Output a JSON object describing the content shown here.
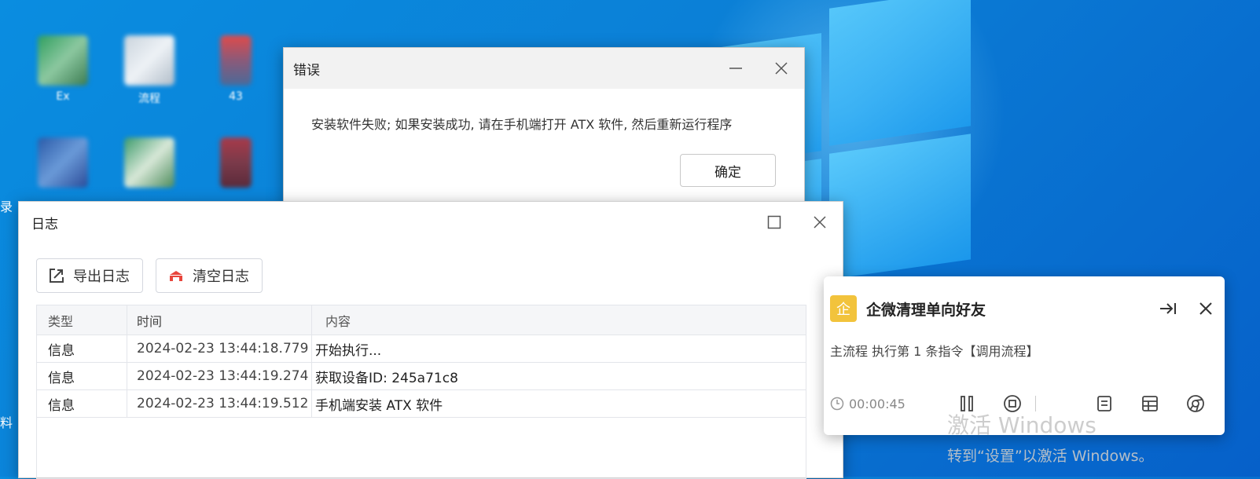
{
  "desktop": {
    "icons": [
      {
        "label": "Ex"
      },
      {
        "label": "流程"
      },
      {
        "label": "43"
      }
    ],
    "left_edge_top": "录",
    "left_edge_bottom": "料"
  },
  "error_dialog": {
    "title": "错误",
    "message": "安装软件失败; 如果安装成功, 请在手机端打开 ATX 软件, 然后重新运行程序",
    "ok_label": "确定"
  },
  "log_window": {
    "title": "日志",
    "toolbar": {
      "export_label": "导出日志",
      "clear_label": "清空日志"
    },
    "columns": {
      "type": "类型",
      "time": "时间",
      "content": "内容"
    },
    "rows": [
      {
        "type": "信息",
        "time": "2024-02-23 13:44:18.779",
        "content": "开始执行..."
      },
      {
        "type": "信息",
        "time": "2024-02-23 13:44:19.274",
        "content": "获取设备ID: 245a71c8"
      },
      {
        "type": "信息",
        "time": "2024-02-23 13:44:19.512",
        "content": "手机端安装 ATX 软件"
      }
    ]
  },
  "task_panel": {
    "badge": "企",
    "title": "企微清理单向好友",
    "status": "主流程 执行第 1 条指令【调用流程】",
    "timer": "00:00:45"
  },
  "watermark": {
    "line1": "激活 Windows",
    "line2": "转到“设置”以激活 Windows。"
  },
  "colors": {
    "desktop_blue": "#0b7fd6",
    "badge_yellow": "#f2c33c",
    "clear_icon_red": "#e8453c"
  }
}
